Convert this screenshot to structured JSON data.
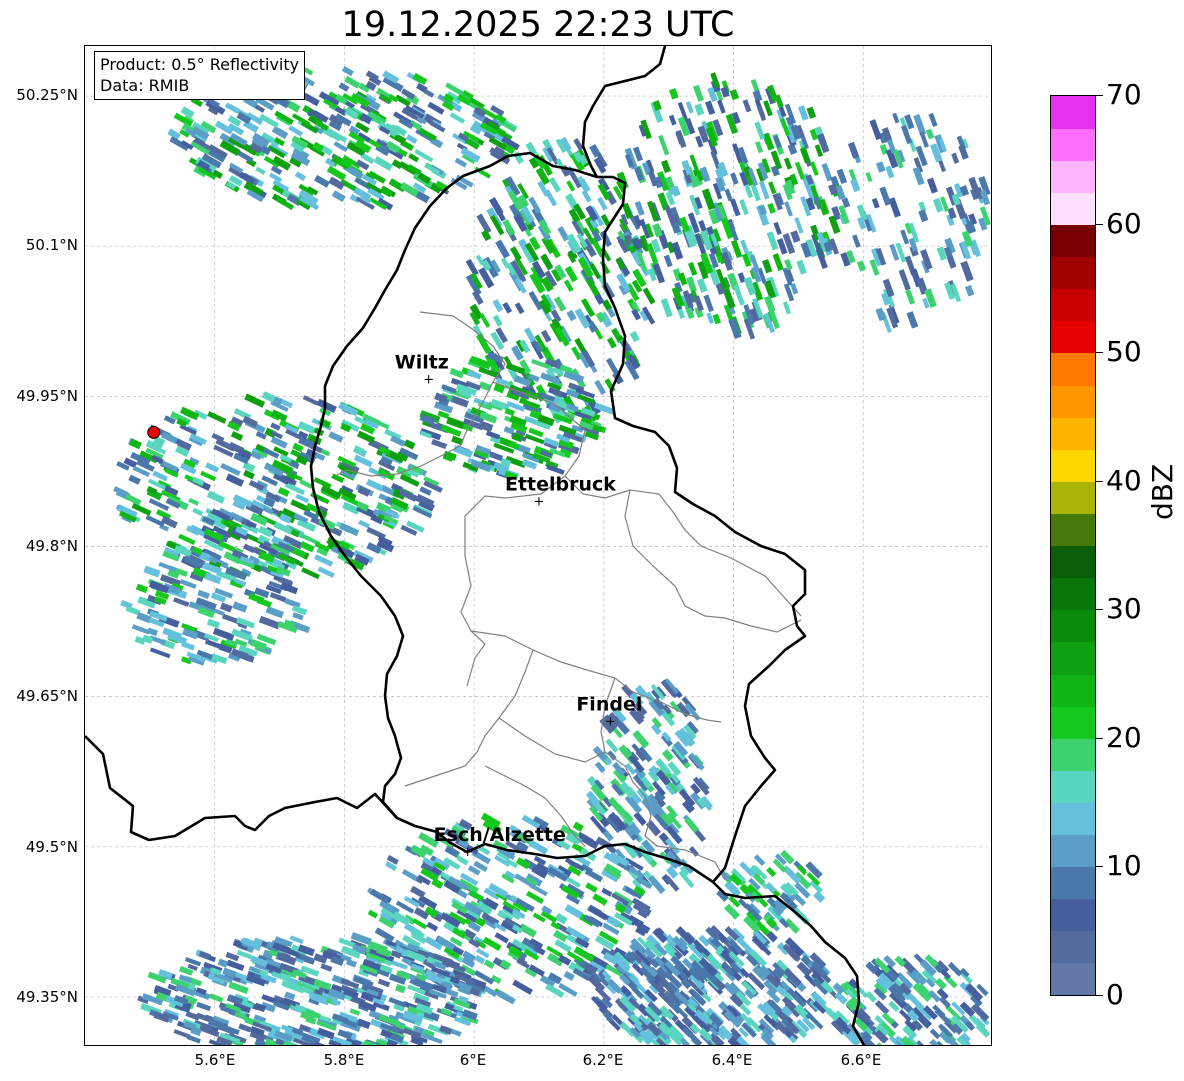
{
  "title": "19.12.2025 22:23 UTC",
  "infobox": {
    "product": "Product: 0.5° Reflectivity",
    "data": "Data: RMIB"
  },
  "map": {
    "extent": {
      "lon": [
        5.4,
        6.8
      ],
      "lat": [
        49.3,
        50.3
      ]
    },
    "lat_labels": [
      "50.25°N",
      "50.1°N",
      "49.95°N",
      "49.8°N",
      "49.65°N",
      "49.5°N",
      "49.35°N"
    ],
    "lon_labels": [
      "5.6°E",
      "5.8°E",
      "6°E",
      "6.2°E",
      "6.4°E",
      "6.6°E"
    ],
    "cities": [
      {
        "name": "Wiltz"
      },
      {
        "name": "Ettelbruck"
      },
      {
        "name": "Findel"
      },
      {
        "name": "Esch/Alzette"
      }
    ],
    "radar_site_color": "#e60000"
  },
  "colorbar": {
    "label": "dBZ",
    "range": [
      0,
      70
    ],
    "tick_labels": [
      "0",
      "10",
      "20",
      "30",
      "40",
      "50",
      "60",
      "70"
    ],
    "colors": [
      "#6478a8",
      "#526a9e",
      "#445e9e",
      "#4a78aa",
      "#5a9ec8",
      "#64c0dc",
      "#5ad6c0",
      "#3cd26e",
      "#14c81e",
      "#10b414",
      "#0ea010",
      "#0a8a0a",
      "#0a760a",
      "#0a5e0a",
      "#46780a",
      "#aab405",
      "#ffd700",
      "#ffb400",
      "#ff9600",
      "#ff7800",
      "#e60000",
      "#c80000",
      "#a00000",
      "#780000",
      "#ffe0ff",
      "#ffb4ff",
      "#ff6eff",
      "#e632f0"
    ]
  }
}
